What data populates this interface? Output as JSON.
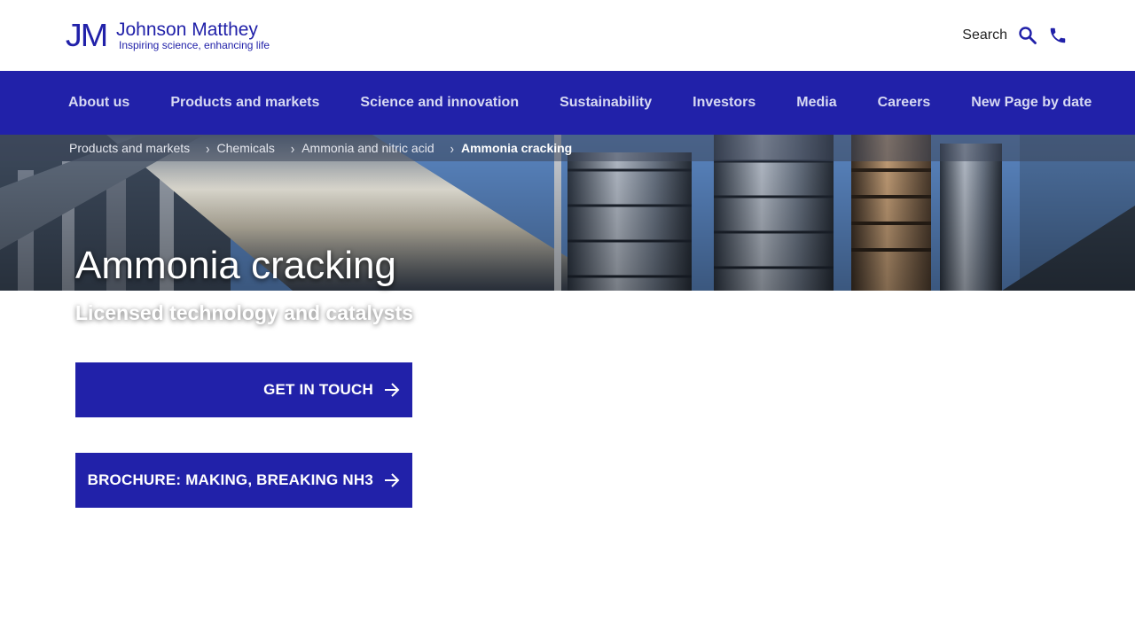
{
  "brand": {
    "monogram": "JM",
    "name": "Johnson Matthey",
    "tagline": "Inspiring science, enhancing life",
    "color": "#2121a9"
  },
  "header": {
    "search_label": "Search",
    "search_icon": "search-icon",
    "phone_icon": "phone-icon"
  },
  "nav": {
    "items": [
      {
        "label": "About us"
      },
      {
        "label": "Products and markets"
      },
      {
        "label": "Science and innovation"
      },
      {
        "label": "Sustainability"
      },
      {
        "label": "Investors"
      },
      {
        "label": "Media"
      },
      {
        "label": "Careers"
      },
      {
        "label": "New Page by date"
      }
    ]
  },
  "breadcrumb": [
    {
      "label": "Products and markets"
    },
    {
      "label": "Chemicals"
    },
    {
      "label": "Ammonia and nitric acid"
    },
    {
      "label": "Ammonia cracking"
    }
  ],
  "hero": {
    "title": "Ammonia cracking",
    "subtitle": "Licensed technology and catalysts"
  },
  "cta": [
    {
      "label": "GET IN TOUCH"
    },
    {
      "label": "BROCHURE: MAKING, BREAKING NH3"
    }
  ]
}
